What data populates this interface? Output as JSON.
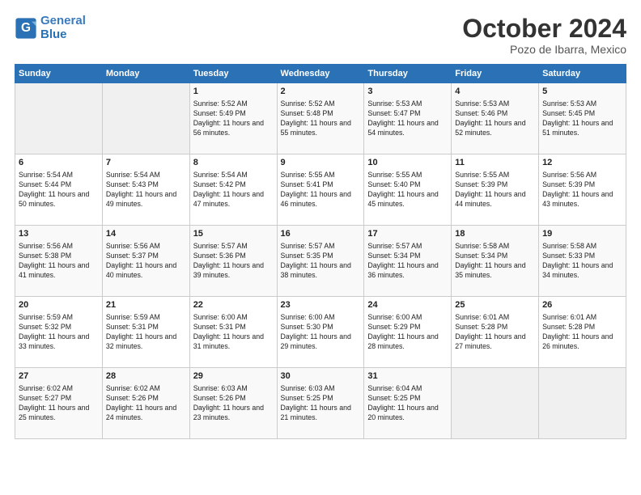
{
  "header": {
    "logo_line1": "General",
    "logo_line2": "Blue",
    "month": "October 2024",
    "location": "Pozo de Ibarra, Mexico"
  },
  "weekdays": [
    "Sunday",
    "Monday",
    "Tuesday",
    "Wednesday",
    "Thursday",
    "Friday",
    "Saturday"
  ],
  "weeks": [
    [
      {
        "day": "",
        "empty": true
      },
      {
        "day": "",
        "empty": true
      },
      {
        "day": "1",
        "sunrise": "5:52 AM",
        "sunset": "5:49 PM",
        "daylight": "11 hours and 56 minutes."
      },
      {
        "day": "2",
        "sunrise": "5:52 AM",
        "sunset": "5:48 PM",
        "daylight": "11 hours and 55 minutes."
      },
      {
        "day": "3",
        "sunrise": "5:53 AM",
        "sunset": "5:47 PM",
        "daylight": "11 hours and 54 minutes."
      },
      {
        "day": "4",
        "sunrise": "5:53 AM",
        "sunset": "5:46 PM",
        "daylight": "11 hours and 52 minutes."
      },
      {
        "day": "5",
        "sunrise": "5:53 AM",
        "sunset": "5:45 PM",
        "daylight": "11 hours and 51 minutes."
      }
    ],
    [
      {
        "day": "6",
        "sunrise": "5:54 AM",
        "sunset": "5:44 PM",
        "daylight": "11 hours and 50 minutes."
      },
      {
        "day": "7",
        "sunrise": "5:54 AM",
        "sunset": "5:43 PM",
        "daylight": "11 hours and 49 minutes."
      },
      {
        "day": "8",
        "sunrise": "5:54 AM",
        "sunset": "5:42 PM",
        "daylight": "11 hours and 47 minutes."
      },
      {
        "day": "9",
        "sunrise": "5:55 AM",
        "sunset": "5:41 PM",
        "daylight": "11 hours and 46 minutes."
      },
      {
        "day": "10",
        "sunrise": "5:55 AM",
        "sunset": "5:40 PM",
        "daylight": "11 hours and 45 minutes."
      },
      {
        "day": "11",
        "sunrise": "5:55 AM",
        "sunset": "5:39 PM",
        "daylight": "11 hours and 44 minutes."
      },
      {
        "day": "12",
        "sunrise": "5:56 AM",
        "sunset": "5:39 PM",
        "daylight": "11 hours and 43 minutes."
      }
    ],
    [
      {
        "day": "13",
        "sunrise": "5:56 AM",
        "sunset": "5:38 PM",
        "daylight": "11 hours and 41 minutes."
      },
      {
        "day": "14",
        "sunrise": "5:56 AM",
        "sunset": "5:37 PM",
        "daylight": "11 hours and 40 minutes."
      },
      {
        "day": "15",
        "sunrise": "5:57 AM",
        "sunset": "5:36 PM",
        "daylight": "11 hours and 39 minutes."
      },
      {
        "day": "16",
        "sunrise": "5:57 AM",
        "sunset": "5:35 PM",
        "daylight": "11 hours and 38 minutes."
      },
      {
        "day": "17",
        "sunrise": "5:57 AM",
        "sunset": "5:34 PM",
        "daylight": "11 hours and 36 minutes."
      },
      {
        "day": "18",
        "sunrise": "5:58 AM",
        "sunset": "5:34 PM",
        "daylight": "11 hours and 35 minutes."
      },
      {
        "day": "19",
        "sunrise": "5:58 AM",
        "sunset": "5:33 PM",
        "daylight": "11 hours and 34 minutes."
      }
    ],
    [
      {
        "day": "20",
        "sunrise": "5:59 AM",
        "sunset": "5:32 PM",
        "daylight": "11 hours and 33 minutes."
      },
      {
        "day": "21",
        "sunrise": "5:59 AM",
        "sunset": "5:31 PM",
        "daylight": "11 hours and 32 minutes."
      },
      {
        "day": "22",
        "sunrise": "6:00 AM",
        "sunset": "5:31 PM",
        "daylight": "11 hours and 31 minutes."
      },
      {
        "day": "23",
        "sunrise": "6:00 AM",
        "sunset": "5:30 PM",
        "daylight": "11 hours and 29 minutes."
      },
      {
        "day": "24",
        "sunrise": "6:00 AM",
        "sunset": "5:29 PM",
        "daylight": "11 hours and 28 minutes."
      },
      {
        "day": "25",
        "sunrise": "6:01 AM",
        "sunset": "5:28 PM",
        "daylight": "11 hours and 27 minutes."
      },
      {
        "day": "26",
        "sunrise": "6:01 AM",
        "sunset": "5:28 PM",
        "daylight": "11 hours and 26 minutes."
      }
    ],
    [
      {
        "day": "27",
        "sunrise": "6:02 AM",
        "sunset": "5:27 PM",
        "daylight": "11 hours and 25 minutes."
      },
      {
        "day": "28",
        "sunrise": "6:02 AM",
        "sunset": "5:26 PM",
        "daylight": "11 hours and 24 minutes."
      },
      {
        "day": "29",
        "sunrise": "6:03 AM",
        "sunset": "5:26 PM",
        "daylight": "11 hours and 23 minutes."
      },
      {
        "day": "30",
        "sunrise": "6:03 AM",
        "sunset": "5:25 PM",
        "daylight": "11 hours and 21 minutes."
      },
      {
        "day": "31",
        "sunrise": "6:04 AM",
        "sunset": "5:25 PM",
        "daylight": "11 hours and 20 minutes."
      },
      {
        "day": "",
        "empty": true
      },
      {
        "day": "",
        "empty": true
      }
    ]
  ],
  "labels": {
    "sunrise_prefix": "Sunrise: ",
    "sunset_prefix": "Sunset: ",
    "daylight_prefix": "Daylight: "
  }
}
